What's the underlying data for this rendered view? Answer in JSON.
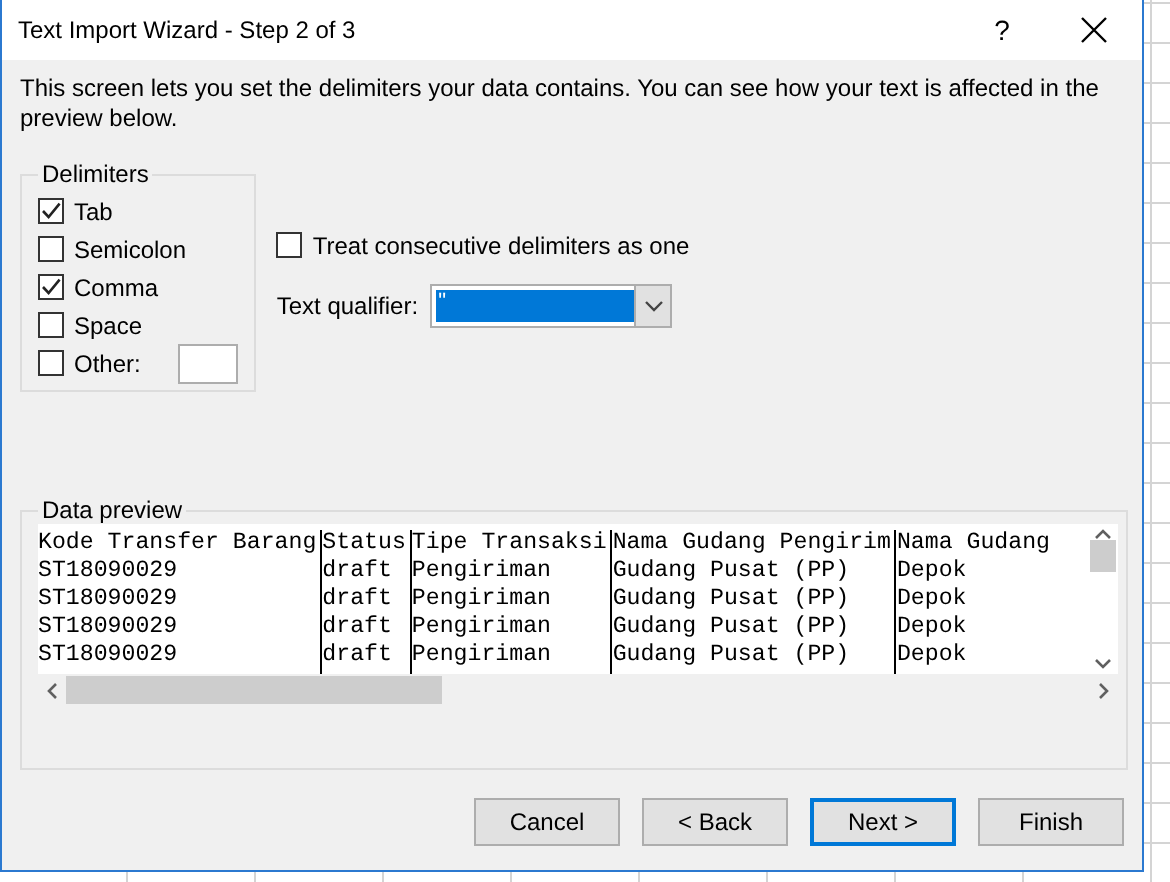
{
  "window": {
    "title": "Text Import Wizard - Step 2 of 3",
    "help": "?"
  },
  "description": "This screen lets you set the delimiters your data contains.  You can see how your text is affected in the preview below.",
  "delimiters": {
    "title": "Delimiters",
    "options": [
      {
        "label": "Tab",
        "checked": true,
        "kind": "plain"
      },
      {
        "label": "Semicolon",
        "checked": false,
        "kind": "plain"
      },
      {
        "label": "Comma",
        "checked": true,
        "kind": "plain"
      },
      {
        "label": "Space",
        "checked": false,
        "kind": "plain"
      },
      {
        "label": "Other:",
        "checked": false,
        "kind": "other"
      }
    ]
  },
  "consecutive": {
    "label": "Treat consecutive delimiters as one",
    "checked": false
  },
  "text_qualifier": {
    "label": "Text qualifier:",
    "value": "\""
  },
  "preview": {
    "title": "Data preview",
    "columns": [
      "Kode Transfer Barang",
      "Status",
      "Tipe Transaksi",
      "Nama Gudang Pengirim",
      "Nama Gudang"
    ],
    "rows": [
      [
        "ST18090029",
        "draft",
        "Pengiriman",
        "Gudang Pusat (PP)",
        "Depok"
      ],
      [
        "ST18090029",
        "draft",
        "Pengiriman",
        "Gudang Pusat (PP)",
        "Depok"
      ],
      [
        "ST18090029",
        "draft",
        "Pengiriman",
        "Gudang Pusat (PP)",
        "Depok"
      ],
      [
        "ST18090029",
        "draft",
        "Pengiriman",
        "Gudang Pusat (PP)",
        "Depok"
      ]
    ]
  },
  "buttons": [
    {
      "label": "Cancel",
      "default": false
    },
    {
      "label": "< Back",
      "default": false
    },
    {
      "label": "Next >",
      "default": true
    },
    {
      "label": "Finish",
      "default": false
    }
  ]
}
